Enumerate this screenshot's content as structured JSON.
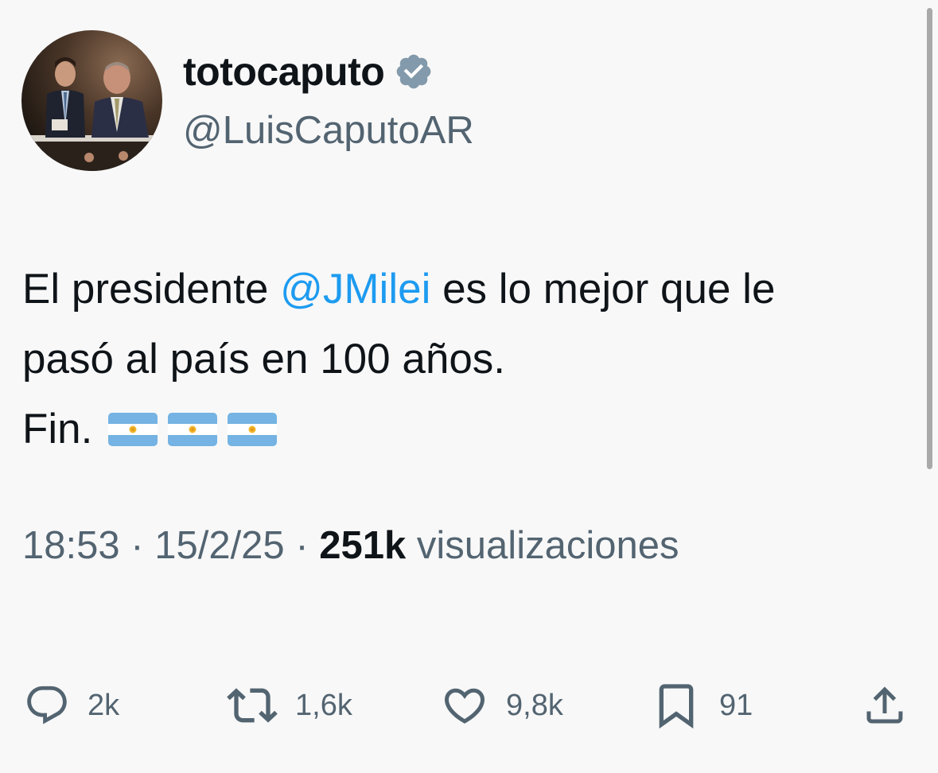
{
  "author": {
    "display_name": "totocaputo",
    "handle": "@LuisCaputoAR",
    "verified_badge_icon": "verified-check-icon",
    "badge_color": "#829aab"
  },
  "tweet": {
    "text_part1": "El presidente ",
    "mention": "@JMilei",
    "text_part2": " es lo mejor que le",
    "line2": "pasó al país en 100 años.",
    "line3": "Fin.",
    "emoji": [
      "argentina-flag",
      "argentina-flag",
      "argentina-flag"
    ],
    "mention_color": "#1d9bf0"
  },
  "meta": {
    "time": "18:53",
    "separator": "·",
    "date": "15/2/25",
    "views_count": "251k",
    "views_label": "visualizaciones"
  },
  "actions": {
    "reply": {
      "icon": "reply-bubble-icon",
      "count": "2k"
    },
    "retweet": {
      "icon": "retweet-icon",
      "count": "1,6k"
    },
    "like": {
      "icon": "heart-icon",
      "count": "9,8k"
    },
    "bookmark": {
      "icon": "bookmark-icon",
      "count": "91"
    },
    "share": {
      "icon": "share-upload-icon"
    }
  },
  "colors": {
    "background": "#f8f8f8",
    "text_primary": "#0f1419",
    "text_secondary": "#536471"
  }
}
